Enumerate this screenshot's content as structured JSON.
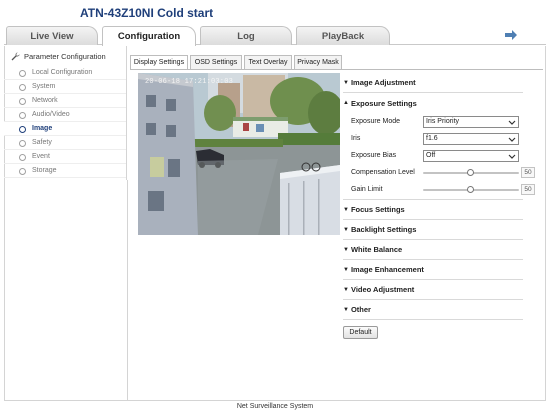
{
  "app": {
    "title": "ATN-43Z10NI Cold start"
  },
  "main_tabs": [
    {
      "label": "Live View"
    },
    {
      "label": "Configuration"
    },
    {
      "label": "Log"
    },
    {
      "label": "PlayBack"
    }
  ],
  "exit_icon": "logout-arrow-icon",
  "sidebar": {
    "header": "Parameter Configuration",
    "header_icon": "wrench-icon",
    "items": [
      {
        "label": "Local Configuration"
      },
      {
        "label": "System"
      },
      {
        "label": "Network"
      },
      {
        "label": "Audio/Video"
      },
      {
        "label": "Image"
      },
      {
        "label": "Safety"
      },
      {
        "label": "Event"
      },
      {
        "label": "Storage"
      }
    ],
    "active": "Image"
  },
  "sub_tabs": [
    {
      "label": "Display Settings"
    },
    {
      "label": "OSD Settings"
    },
    {
      "label": "Text Overlay"
    },
    {
      "label": "Privacy Mask"
    }
  ],
  "video": {
    "osd_text": "20-06-18 17:21:03:03"
  },
  "sections": {
    "image_adjustment": "Image Adjustment",
    "exposure_settings": "Exposure Settings",
    "focus_settings": "Focus Settings",
    "backlight_settings": "Backlight Settings",
    "white_balance": "White Balance",
    "image_enhancement": "Image Enhancement",
    "video_adjustment": "Video Adjustment",
    "other": "Other"
  },
  "exposure": {
    "mode_label": "Exposure Mode",
    "mode_value": "Iris Priority",
    "iris_label": "Iris",
    "iris_value": "f1.6",
    "bias_label": "Exposure Bias",
    "bias_value": "Off",
    "compensation_label": "Compensation Level",
    "compensation_value": "50",
    "compensation_level_fraction": 0.5,
    "gain_label": "Gain Limit",
    "gain_value": "50",
    "gain_level_fraction": 0.5
  },
  "buttons": {
    "default_label": "Default"
  },
  "footer": "Net Surveillance System"
}
